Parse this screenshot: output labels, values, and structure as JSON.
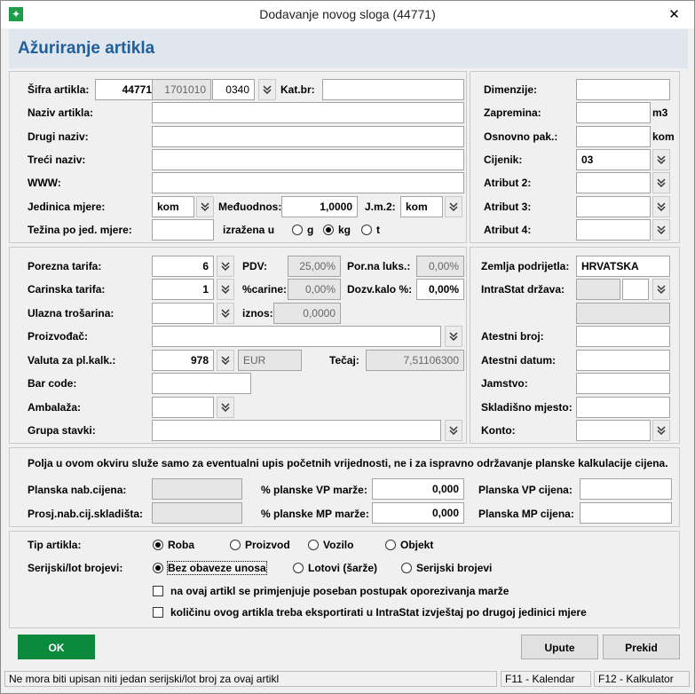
{
  "window": {
    "title": "Dodavanje novog sloga (44771)",
    "close": "✕"
  },
  "heading": "Ažuriranje artikla",
  "colors": {
    "accent": "#1f5f9c",
    "ok_button": "#0b8a3e"
  },
  "article": {
    "sifra_label": "Šifra artikla:",
    "sifra": "44771",
    "grupa": "1701010",
    "podgrupa": "0340",
    "katbr_label": "Kat.br:",
    "katbr": "",
    "naziv_label": "Naziv artikla:",
    "naziv": "",
    "drugi_label": "Drugi naziv:",
    "drugi": "",
    "treci_label": "Treći naziv:",
    "treci": "",
    "www_label": "WWW:",
    "www": "",
    "jm_label": "Jedinica mjere:",
    "jm": "kom",
    "meduodnos_label": "Međuodnos:",
    "meduodnos": "1,0000",
    "jm2_label": "J.m.2:",
    "jm2": "kom",
    "tezina_label": "Težina po jed. mjere:",
    "tezina": "",
    "izrazena_label": "izražena u",
    "units": [
      {
        "label": "g",
        "selected": false
      },
      {
        "label": "kg",
        "selected": true
      },
      {
        "label": "t",
        "selected": false
      }
    ]
  },
  "right_attrs": {
    "dimenzije_label": "Dimenzije:",
    "dimenzije": "",
    "zapremina_label": "Zapremina:",
    "zapremina": "",
    "zapremina_unit": "m3",
    "osnovno_label": "Osnovno pak.:",
    "osnovno": "",
    "osnovno_unit": "kom",
    "cjenik_label": "Cijenik:",
    "cjenik": "03",
    "atr2_label": "Atribut 2:",
    "atr2": "",
    "atr3_label": "Atribut 3:",
    "atr3": "",
    "atr4_label": "Atribut 4:",
    "atr4": ""
  },
  "tax": {
    "porezna_label": "Porezna tarifa:",
    "porezna": "6",
    "pdv_label": "PDV:",
    "pdv": "25,00%",
    "porlux_label": "Por.na luks.:",
    "porlux": "0,00%",
    "carinska_label": "Carinska tarifa:",
    "carinska": "1",
    "carine_label": "%carine:",
    "carine": "0,00%",
    "dozv_label": "Dozv.kalo %:",
    "dozv": "0,00%",
    "ulazna_label": "Ulazna trošarina:",
    "ulazna": "",
    "iznos_label": "iznos:",
    "iznos": "0,0000",
    "proizvodac_label": "Proizvođač:",
    "proizvodac": "",
    "valuta_label": "Valuta za pl.kalk.:",
    "valuta": "978",
    "valuta_code": "EUR",
    "tecaj_label": "Tečaj:",
    "tecaj": "7,51106300",
    "barcode_label": "Bar code:",
    "barcode": "",
    "ambalaza_label": "Ambalaža:",
    "ambalaza": "",
    "grupa_label": "Grupa stavki:",
    "grupa": ""
  },
  "origin": {
    "zemlja_label": "Zemlja podrijetla:",
    "zemlja": "HRVATSKA",
    "intrastat_label": "IntraStat država:",
    "intrastat": "",
    "intrastat2": "",
    "intrastat_name": "",
    "atestni_broj_label": "Atestni broj:",
    "atestni_broj": "",
    "atestni_datum_label": "Atestni datum:",
    "atestni_datum": "",
    "jamstvo_label": "Jamstvo:",
    "jamstvo": "",
    "skladisno_label": "Skladišno mjesto:",
    "skladisno": "",
    "konto_label": "Konto:",
    "konto": ""
  },
  "planning": {
    "note": "Polja u ovom okviru služe samo za eventualni upis početnih vrijednosti, ne i za ispravno održavanje planske kalkulacije cijena.",
    "planska_nab_label": "Planska nab.cijena:",
    "planska_nab": "",
    "pvp_label": "% planske VP marže:",
    "pvp": "0,000",
    "plan_vp_label": "Planska VP cijena:",
    "plan_vp": "",
    "prosj_label": "Prosj.nab.cij.skladišta:",
    "prosj": "",
    "pmp_label": "% planske MP marže:",
    "pmp": "0,000",
    "plan_mp_label": "Planska MP cijena:",
    "plan_mp": ""
  },
  "type": {
    "tip_label": "Tip artikla:",
    "tip_options": [
      {
        "label": "Roba",
        "selected": true
      },
      {
        "label": "Proizvod",
        "selected": false
      },
      {
        "label": "Vozilo",
        "selected": false
      },
      {
        "label": "Objekt",
        "selected": false
      }
    ],
    "serijski_label": "Serijski/lot brojevi:",
    "serijski_options": [
      {
        "label": "Bez obaveze unosa",
        "selected": true
      },
      {
        "label": "Lotovi (šarže)",
        "selected": false
      },
      {
        "label": "Serijski brojevi",
        "selected": false
      }
    ],
    "check1": "na ovaj artikl se primjenjuje poseban postupak oporezivanja marže",
    "check2": "količinu ovog artikla treba eksportirati u IntraStat izvještaj po drugoj jedinici mjere"
  },
  "buttons": {
    "ok": "OK",
    "upute": "Upute",
    "prekid": "Prekid"
  },
  "status": {
    "message": "Ne mora biti upisan niti jedan serijski/lot broj za ovaj artikl",
    "f11": "F11 - Kalendar",
    "f12": "F12 - Kalkulator"
  }
}
